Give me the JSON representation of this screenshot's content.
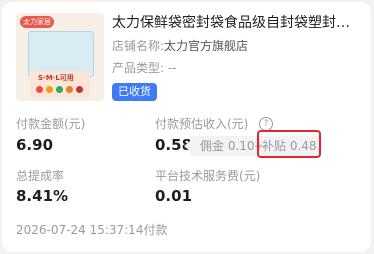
{
  "product": {
    "thumb_tag": "太力家居",
    "thumb_panel_text": "S·M·L可用",
    "title": "太力保鲜袋密封袋食品级自封袋塑封袋加…",
    "store_label": "店铺名称:",
    "store_name": "太力官方旗舰店",
    "category_label": "产品类型:",
    "category_value": "--",
    "status_badge": "已收货"
  },
  "stats": {
    "paid_amount_label": "付款金额(元)",
    "paid_amount_value": "6.90",
    "estimated_income_label": "付款预估收入(元)",
    "estimated_income_value": "0.58",
    "help_icon": "question-circle-icon",
    "commission_text": "佣金 0.10",
    "separator": "+",
    "subsidy_text": "补贴 0.48",
    "commission_rate_label": "总提成率",
    "commission_rate_value": "8.41%",
    "platform_fee_label": "平台技术服务费(元)",
    "platform_fee_value": "0.01"
  },
  "footer": {
    "payment_time": "2026-07-24 15:37:14付款"
  },
  "colors": {
    "badge_blue": "#3f7cf3",
    "highlight_red": "#e3262f"
  }
}
